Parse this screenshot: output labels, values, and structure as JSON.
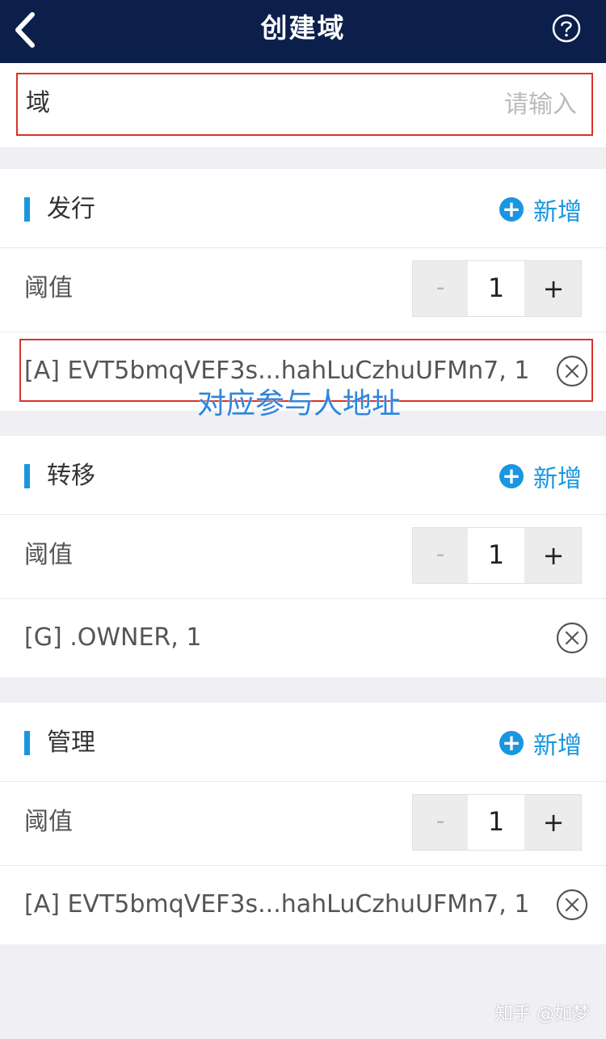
{
  "nav": {
    "title": "创建域",
    "back_icon": "chevron-left-icon",
    "help_icon": "question-circle-icon"
  },
  "domain": {
    "label": "域",
    "placeholder": "请输入",
    "value": ""
  },
  "sections": [
    {
      "title": "发行",
      "add_label": "新增",
      "threshold_label": "阈值",
      "stepper": {
        "minus": "-",
        "value": "1",
        "plus": "+"
      },
      "entries": [
        "[A] EVT5bmqVEF3s...hahLuCzhuUFMn7, 1"
      ]
    },
    {
      "title": "转移",
      "add_label": "新增",
      "threshold_label": "阈值",
      "stepper": {
        "minus": "-",
        "value": "1",
        "plus": "+"
      },
      "entries": [
        "[G] .OWNER, 1"
      ]
    },
    {
      "title": "管理",
      "add_label": "新增",
      "threshold_label": "阈值",
      "stepper": {
        "minus": "-",
        "value": "1",
        "plus": "+"
      },
      "entries": [
        "[A] EVT5bmqVEF3s...hahLuCzhuUFMn7, 1"
      ]
    }
  ],
  "annotation": "对应参与人地址",
  "watermark": "知乎 @如梦",
  "colors": {
    "nav_bg": "#0b1f4a",
    "accent": "#1a96e0",
    "highlight": "#d9322a",
    "annotation": "#2e86de"
  }
}
